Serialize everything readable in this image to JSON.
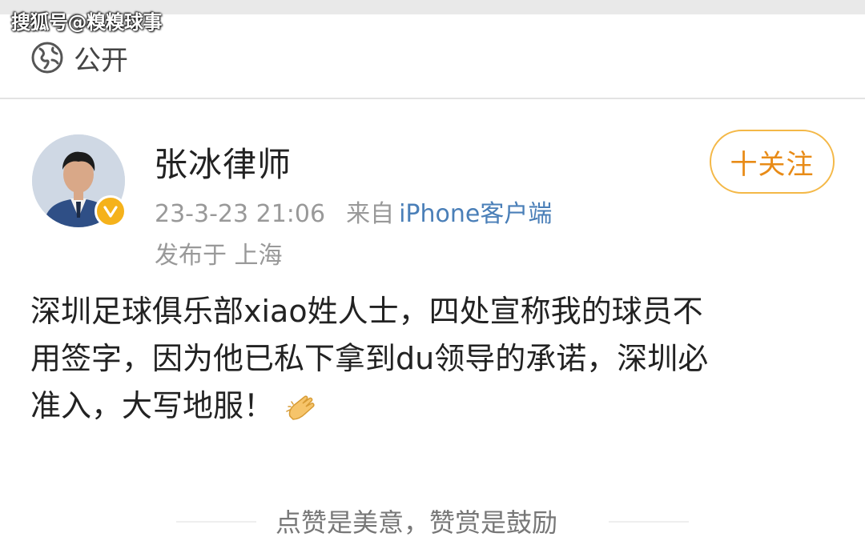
{
  "watermark": "搜狐号@糗糗球事",
  "visibility": {
    "icon": "globe-icon",
    "label": "公开"
  },
  "post": {
    "author": "张冰律师",
    "timestamp": "23-3-23 21:06",
    "source_prefix": "来自",
    "source": "iPhone客户端",
    "location": "发布于 上海",
    "follow_label": "十关注",
    "lines": [
      "深圳足球俱乐部xiao姓人士，四处宣称我的球员不",
      "用签字，因为他已私下拿到du领导的承诺，深圳必",
      "准入，大写地服！"
    ],
    "emoji": "clapping-hands-icon"
  },
  "reward_text": "点赞是美意，赞赏是鼓励",
  "colors": {
    "accent": "#e88b17",
    "follow_border": "#f4b847",
    "verify_badge": "#f5b21b",
    "link_blue": "#4a7fb8",
    "meta_gray": "#999999"
  }
}
